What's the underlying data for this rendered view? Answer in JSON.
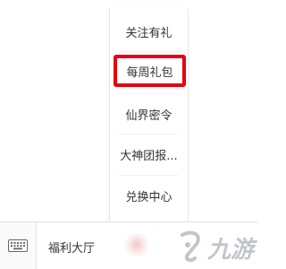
{
  "side_menu": {
    "items": [
      {
        "label": "关注有礼"
      },
      {
        "label": "每周礼包"
      },
      {
        "label": "仙界密令"
      },
      {
        "label": "大神团报..."
      },
      {
        "label": "兑换中心"
      }
    ],
    "highlight_color": "#e60012"
  },
  "bottom_bar": {
    "keyboard_icon": "keyboard-icon",
    "label": "福利大厅"
  },
  "watermark": {
    "icon": "jiuyou-logo",
    "text": "九游"
  }
}
